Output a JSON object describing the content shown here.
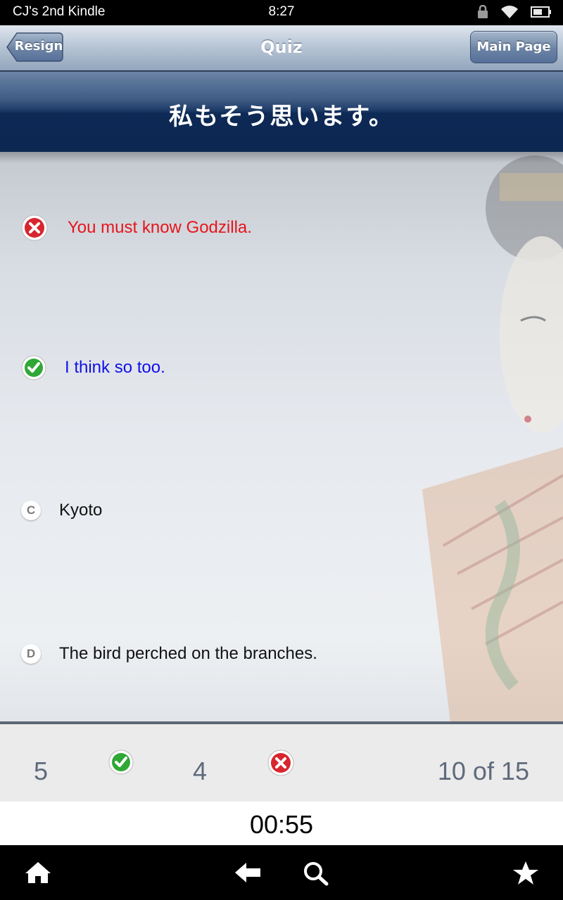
{
  "status_bar": {
    "device_name": "CJ's 2nd Kindle",
    "time": "8:27",
    "icons": [
      "lock-icon",
      "wifi-icon",
      "battery-icon"
    ]
  },
  "navbar": {
    "title": "Quiz",
    "resign_label": "Resign",
    "main_page_label": "Main Page"
  },
  "question": {
    "text": "私もそう思います。"
  },
  "answers": [
    {
      "marker": "wrong-icon",
      "text": "You must know Godzilla.",
      "color": "#e8141c"
    },
    {
      "marker": "correct-icon",
      "text": "I think so too.",
      "color": "#1010e6"
    },
    {
      "marker": "C",
      "text": "Kyoto",
      "color": "#111111"
    },
    {
      "marker": "D",
      "text": "The bird perched on the branches.",
      "color": "#111111"
    }
  ],
  "score": {
    "correct_count": "5",
    "wrong_count": "4",
    "progress": "10 of 15"
  },
  "timer": "00:55",
  "system_bar": {
    "icons": [
      "home-icon",
      "back-icon",
      "search-icon",
      "favorites-icon"
    ]
  },
  "colors": {
    "correct": "#2fa836",
    "wrong": "#d7262f",
    "header_dark": "#0c2751"
  }
}
